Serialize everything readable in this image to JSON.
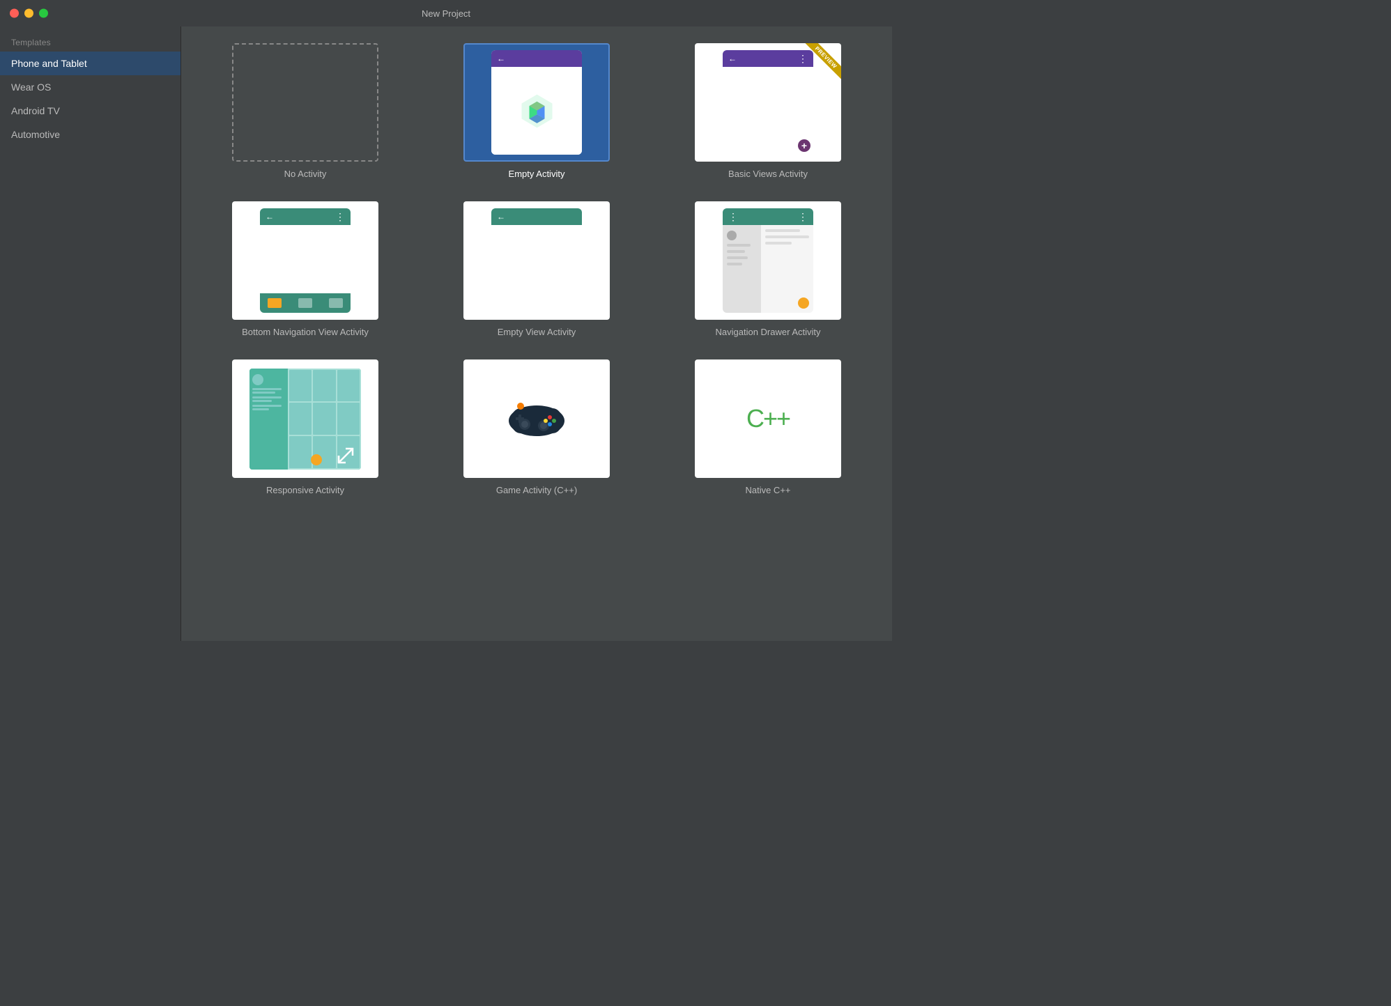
{
  "window": {
    "title": "New Project"
  },
  "sidebar": {
    "section_label": "Templates",
    "items": [
      {
        "id": "phone-tablet",
        "label": "Phone and Tablet",
        "active": true
      },
      {
        "id": "wear-os",
        "label": "Wear OS",
        "active": false
      },
      {
        "id": "android-tv",
        "label": "Android TV",
        "active": false
      },
      {
        "id": "automotive",
        "label": "Automotive",
        "active": false
      }
    ]
  },
  "templates": [
    {
      "id": "no-activity",
      "label": "No Activity"
    },
    {
      "id": "empty-activity",
      "label": "Empty Activity",
      "selected": true
    },
    {
      "id": "basic-views-activity",
      "label": "Basic Views Activity",
      "preview": true
    },
    {
      "id": "bottom-nav-activity",
      "label": "Bottom Navigation View Activity"
    },
    {
      "id": "empty-view-activity",
      "label": "Empty View Activity"
    },
    {
      "id": "navigation-drawer-activity",
      "label": "Navigation Drawer Activity"
    },
    {
      "id": "responsive-activity",
      "label": "Responsive Activity"
    },
    {
      "id": "game-activity",
      "label": "Game Activity (C++)"
    },
    {
      "id": "native-cpp",
      "label": "Native C++"
    }
  ]
}
